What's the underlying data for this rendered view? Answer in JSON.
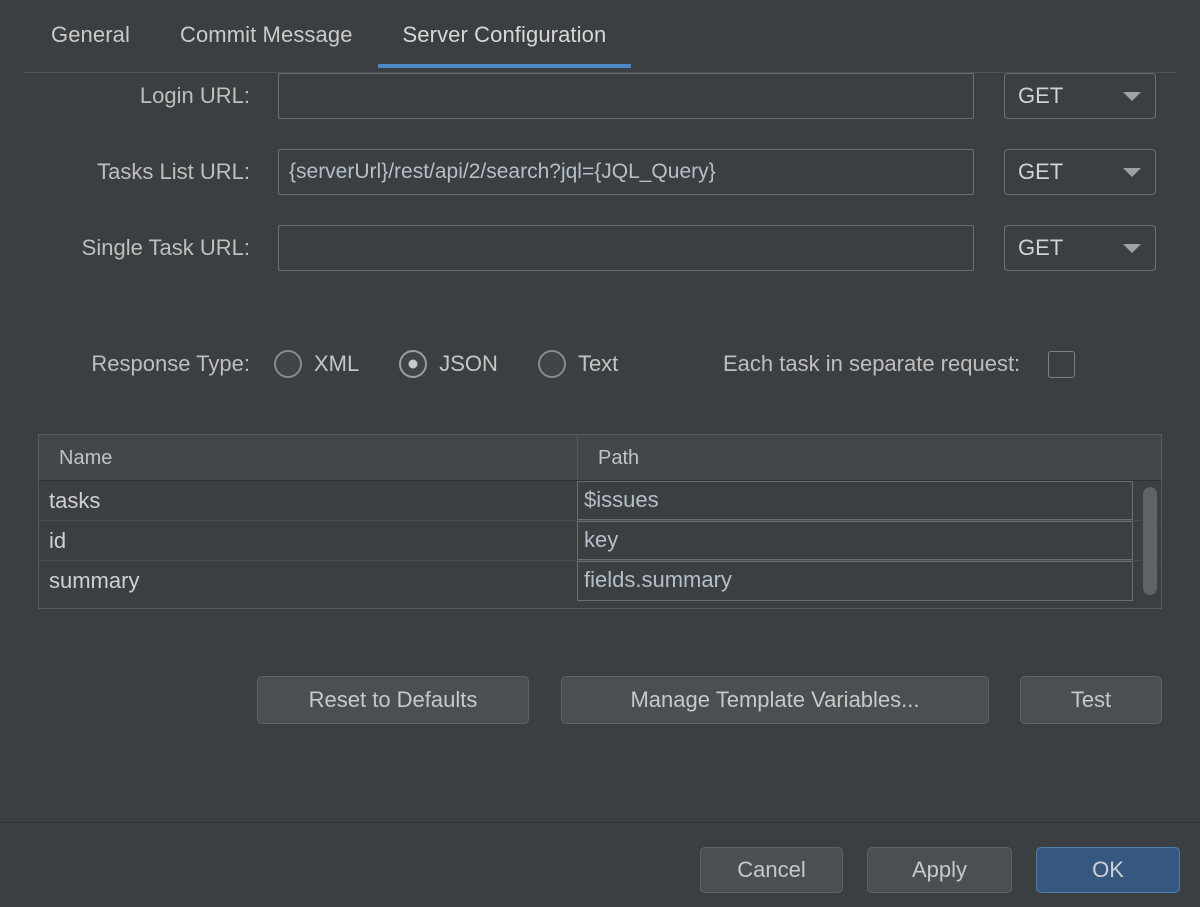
{
  "tabs": [
    {
      "label": "General",
      "active": false
    },
    {
      "label": "Commit Message",
      "active": false
    },
    {
      "label": "Server Configuration",
      "active": true
    }
  ],
  "form": {
    "rows": [
      {
        "label": "Login URL:",
        "value": "",
        "placeholder": "",
        "method": "GET"
      },
      {
        "label": "Tasks List URL:",
        "value": "{serverUrl}/rest/api/2/search?jql={JQL_Query}",
        "placeholder": "",
        "method": "GET"
      },
      {
        "label": "Single Task URL:",
        "value": "",
        "placeholder": "",
        "method": "GET"
      }
    ]
  },
  "response_type": {
    "label": "Response Type:",
    "options": [
      {
        "label": "XML",
        "selected": false
      },
      {
        "label": "JSON",
        "selected": true
      },
      {
        "label": "Text",
        "selected": false
      }
    ]
  },
  "separate_request": {
    "label": "Each task in separate request:",
    "checked": false
  },
  "table": {
    "columns": [
      "Name",
      "Path"
    ],
    "rows": [
      {
        "name": "tasks",
        "path": "$issues"
      },
      {
        "name": "id",
        "path": "key"
      },
      {
        "name": "summary",
        "path": "fields.summary"
      }
    ]
  },
  "actions": {
    "reset": "Reset to Defaults",
    "manage": "Manage Template Variables...",
    "test": "Test"
  },
  "footer": {
    "cancel": "Cancel",
    "apply": "Apply",
    "ok": "OK"
  },
  "colors": {
    "background": "#3c3f41",
    "accent_tab": "#4a88c7",
    "accent_default_button": "#365880",
    "value_text": "#b5bfc9"
  }
}
